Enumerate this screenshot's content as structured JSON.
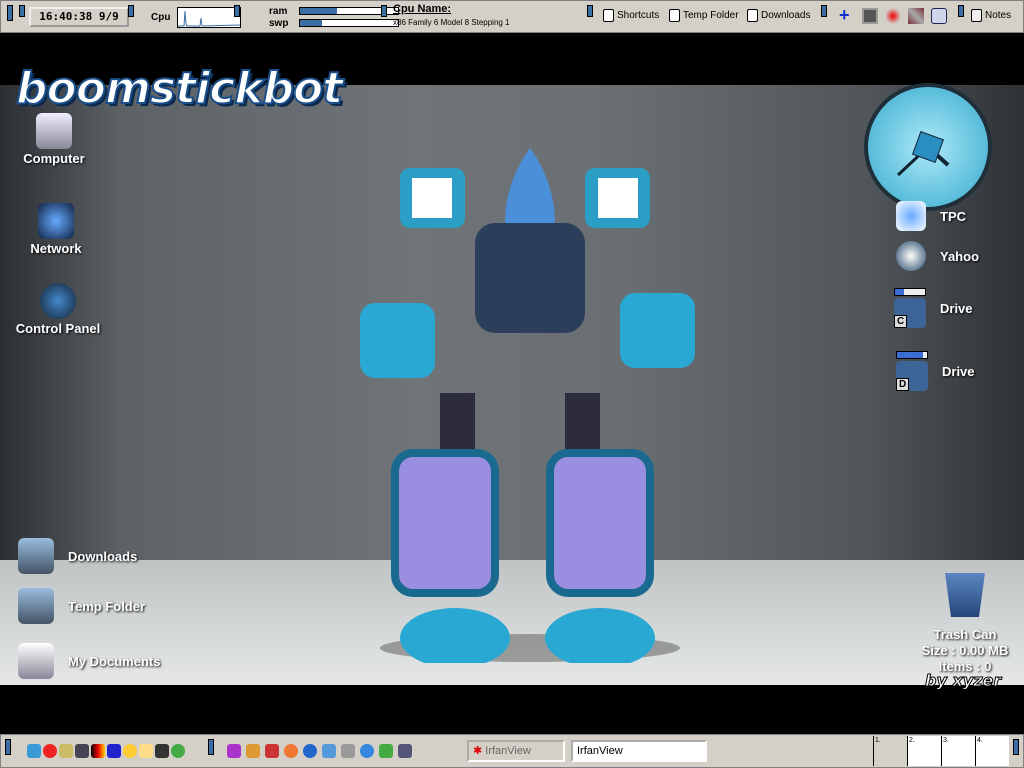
{
  "topbar": {
    "clock": "16:40:38  9/9",
    "cpu_label": "Cpu",
    "ram_label": "ram",
    "swp_label": "swp",
    "ram_usage": 0.38,
    "swp_usage": 0.22,
    "cpu_name_label": "Cpu Name:",
    "cpu_name": "x86 Family 6 Model 8 Stepping 1",
    "shortcuts": [
      {
        "label": "Shortcuts"
      },
      {
        "label": "Temp Folder"
      },
      {
        "label": "Downloads"
      }
    ],
    "notes": "Notes"
  },
  "desktop": {
    "logo": "boomstickbot",
    "credit": "by xyzer",
    "left_icons": [
      {
        "label": "Computer"
      },
      {
        "label": "Network"
      },
      {
        "label": "Control Panel"
      }
    ],
    "bottom_left_icons": [
      {
        "label": "Downloads"
      },
      {
        "label": "Temp Folder"
      },
      {
        "label": "My Documents"
      }
    ],
    "right_icons": [
      {
        "label": "TPC"
      },
      {
        "label": "Yahoo"
      },
      {
        "label": "Drive",
        "letter": "C",
        "usage": 0.3
      },
      {
        "label": "Drive",
        "letter": "D",
        "usage": 0.85
      }
    ],
    "trash": {
      "title": "Trash Can",
      "size": "Size : 0.00 MB",
      "items": "Items : 0"
    }
  },
  "taskbar": {
    "tasks": [
      {
        "label": "IrfanView"
      }
    ],
    "run_input": "IrfanView",
    "pager": [
      "1.",
      "2.",
      "3.",
      "4."
    ]
  }
}
